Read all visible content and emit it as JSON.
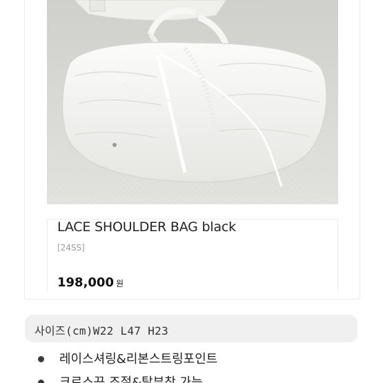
{
  "product": {
    "name": "LACE SHOULDER BAG black",
    "season": "[24SS]",
    "price": "198,000",
    "price_unit": "원"
  },
  "size": {
    "text": "사이즈(cm)W22  L47  H23"
  },
  "features": [
    "레이스셔링&리본스트링포인트",
    "크로스끈 조절&탈부착 가능"
  ],
  "colors": {
    "bag": "#f4f4f2",
    "background_photo": "#d9d9d6",
    "size_bar": "#f0f0f0"
  }
}
